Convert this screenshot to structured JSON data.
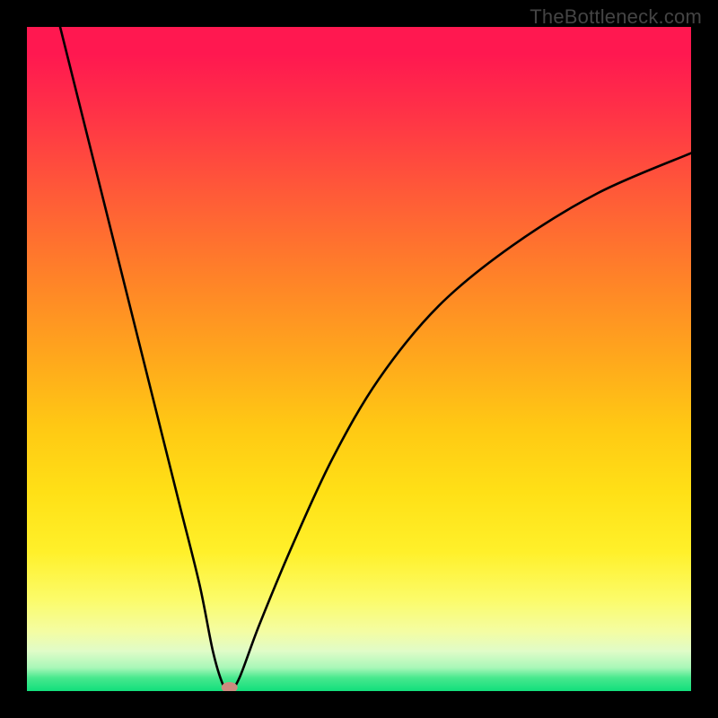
{
  "watermark": "TheBottleneck.com",
  "chart_data": {
    "type": "line",
    "title": "",
    "xlabel": "",
    "ylabel": "",
    "xlim": [
      0,
      100
    ],
    "ylim": [
      0,
      100
    ],
    "grid": false,
    "background": "rainbow-vertical-gradient",
    "legend": false,
    "series": [
      {
        "name": "bottleneck-curve",
        "color": "#000000",
        "x": [
          5,
          8,
          11,
          14,
          17,
          20,
          23,
          26,
          28,
          29.5,
          30.5,
          32,
          35,
          40,
          46,
          53,
          62,
          73,
          86,
          100
        ],
        "values": [
          100,
          88,
          76,
          64,
          52,
          40,
          28,
          16,
          6,
          1,
          0,
          2,
          10,
          22,
          35,
          47,
          58,
          67,
          75,
          81
        ]
      }
    ],
    "marker": {
      "name": "bottleneck-point",
      "x": 30.5,
      "y": 0,
      "color": "#cc8b7f",
      "shape": "ellipse"
    }
  }
}
